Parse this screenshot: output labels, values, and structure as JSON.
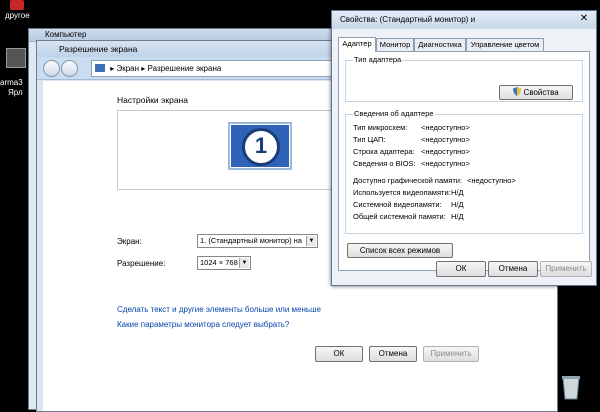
{
  "desktop": {
    "icon1_label": "другое",
    "icon2_label": "arma3",
    "icon2_sub": "Ярл",
    "recycle_bin_icon": "recycle-bin-icon"
  },
  "back_window": {
    "title": "Компьютер"
  },
  "res_window": {
    "title": "Разрешение экрана",
    "breadcrumb": [
      "Экран",
      "Разрешение экрана"
    ],
    "heading": "Настройки экрана",
    "monitor_number": "1",
    "display_label": "Экран:",
    "display_value": "1. (Стандартный монитор) на",
    "resolution_label": "Разрешение:",
    "resolution_value": "1024 × 768",
    "link1": "Сделать текст и другие элементы больше или меньше",
    "link2": "Какие параметры монитора следует выбрать?",
    "ok": "ОК",
    "cancel": "Отмена",
    "apply": "Применить"
  },
  "dialog": {
    "title": "Свойства: (Стандартный монитор) и",
    "tabs": [
      "Адаптер",
      "Монитор",
      "Диагностика",
      "Управление цветом"
    ],
    "adapter_type_title": "Тип адаптера",
    "properties_button": "Свойства",
    "adapter_info_title": "Сведения об адаптере",
    "info_rows": [
      {
        "label": "Тип микросхем:",
        "value": "<недоступно>"
      },
      {
        "label": "Тип ЦАП:",
        "value": "<недоступно>"
      },
      {
        "label": "Строка адаптера:",
        "value": "<недоступно>"
      },
      {
        "label": "Сведения о BIOS:",
        "value": "<недоступно>"
      }
    ],
    "memory_rows": [
      {
        "label": "Доступно графической памяти:",
        "value": "<недоступно>"
      },
      {
        "label": "Используется видеопамяти:",
        "value": "Н/Д"
      },
      {
        "label": "Системной видеопамяти:",
        "value": "Н/Д"
      },
      {
        "label": "Общей системной памяти:",
        "value": "Н/Д"
      }
    ],
    "list_modes_button": "Список всех режимов",
    "ok": "ОК",
    "cancel": "Отмена",
    "apply": "Применить"
  }
}
